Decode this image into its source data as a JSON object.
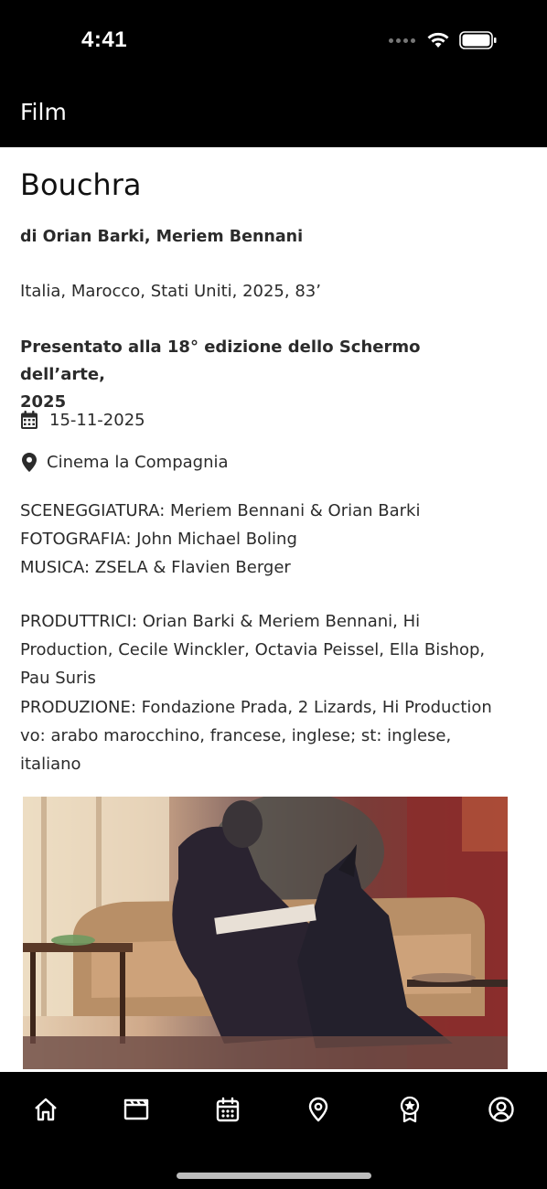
{
  "status_bar": {
    "time": "4:41"
  },
  "header": {
    "title": "Film"
  },
  "film": {
    "title": "Bouchra",
    "directors": "di Orian Barki, Meriem Bennani",
    "origin": "Italia, Marocco, Stati Uniti, 2025, 83’",
    "presented_line1": "Presentato alla 18° edizione dello Schermo dell’arte,",
    "presented_line2": "2025",
    "date": "15-11-2025",
    "venue": "Cinema la Compagnia",
    "credits_block1": [
      "SCENEGGIATURA: Meriem Bennani & Orian Barki",
      "FOTOGRAFIA: John Michael Boling",
      "MUSICA: ZSELA & Flavien Berger"
    ],
    "credits_block2": [
      "PRODUTTRICI: Orian Barki & Meriem Bennani, Hi",
      "Production, Cecile Winckler, Octavia Peissel, Ella Bishop,",
      "Pau Suris",
      "PRODUZIONE: Fondazione Prada, 2 Lizards, Hi Production",
      "vo: arabo marocchino, francese, inglese; st: inglese,",
      "italiano"
    ]
  },
  "icons": {
    "date": "calendar-icon",
    "venue": "map-pin-icon"
  },
  "tab_bar": {
    "tabs": [
      {
        "icon": "home-icon"
      },
      {
        "icon": "film-icon"
      },
      {
        "icon": "calendar-icon"
      },
      {
        "icon": "map-pin-icon"
      },
      {
        "icon": "award-icon"
      },
      {
        "icon": "user-icon"
      }
    ]
  }
}
